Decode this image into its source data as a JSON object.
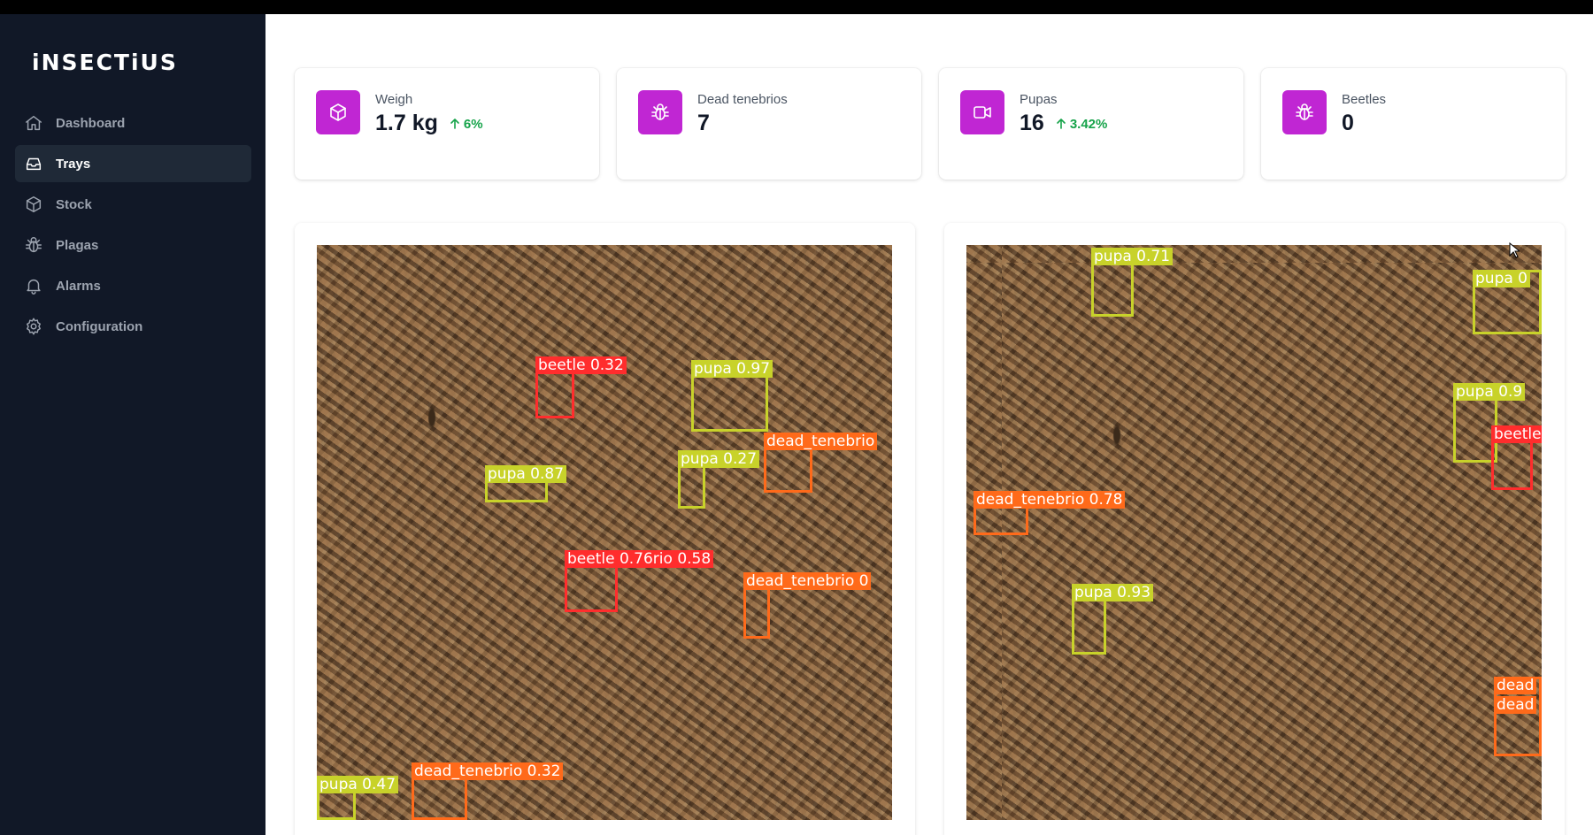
{
  "app": {
    "logo": "iNSECTiUS"
  },
  "sidebar": {
    "items": [
      {
        "label": "Dashboard",
        "icon": "home-icon",
        "active": false
      },
      {
        "label": "Trays",
        "icon": "inbox-icon",
        "active": true
      },
      {
        "label": "Stock",
        "icon": "cube-icon",
        "active": false
      },
      {
        "label": "Plagas",
        "icon": "bug-icon",
        "active": false
      },
      {
        "label": "Alarms",
        "icon": "bell-icon",
        "active": false
      },
      {
        "label": "Configuration",
        "icon": "gear-icon",
        "active": false
      }
    ]
  },
  "stats": [
    {
      "label": "Weigh",
      "value": "1.7 kg",
      "change": "6%",
      "icon": "cube-icon"
    },
    {
      "label": "Dead tenebrios",
      "value": "7",
      "change": "",
      "icon": "bug-icon"
    },
    {
      "label": "Pupas",
      "value": "16",
      "change": "3.42%",
      "icon": "video-camera-icon"
    },
    {
      "label": "Beetles",
      "value": "0",
      "change": "",
      "icon": "bug-icon"
    }
  ],
  "colors": {
    "accent": "#c026d3",
    "positive": "#16a34a",
    "sidebar_bg": "#111827",
    "pupa_box": "#c8d22a",
    "beetle_box": "#ff2d2d",
    "dead_tenebrio_box": "#ff6a1a"
  },
  "detections": {
    "left": [
      {
        "label": "beetle 0.32",
        "class": "beetle"
      },
      {
        "label": "pupa 0.97",
        "class": "pupa"
      },
      {
        "label": "dead_tenebrio",
        "class": "dead_tenebrio"
      },
      {
        "label": "pupa 0.87",
        "class": "pupa"
      },
      {
        "label": "pupa 0.27",
        "class": "pupa"
      },
      {
        "label": "beetle 0.76rio 0.58",
        "class": "beetle"
      },
      {
        "label": "dead_tenebrio 0",
        "class": "dead_tenebrio"
      },
      {
        "label": "pupa 0.47",
        "class": "pupa"
      },
      {
        "label": "dead_tenebrio 0.32",
        "class": "dead_tenebrio"
      }
    ],
    "right": [
      {
        "label": "pupa 0.71",
        "class": "pupa"
      },
      {
        "label": "pupa 0",
        "class": "pupa"
      },
      {
        "label": "pupa 0.9",
        "class": "pupa"
      },
      {
        "label": "beetle",
        "class": "beetle"
      },
      {
        "label": "dead_tenebrio 0.78",
        "class": "dead_tenebrio"
      },
      {
        "label": "pupa 0.93",
        "class": "pupa"
      },
      {
        "label": "dead",
        "class": "dead_tenebrio"
      },
      {
        "label": "dead",
        "class": "dead_tenebrio"
      }
    ]
  }
}
